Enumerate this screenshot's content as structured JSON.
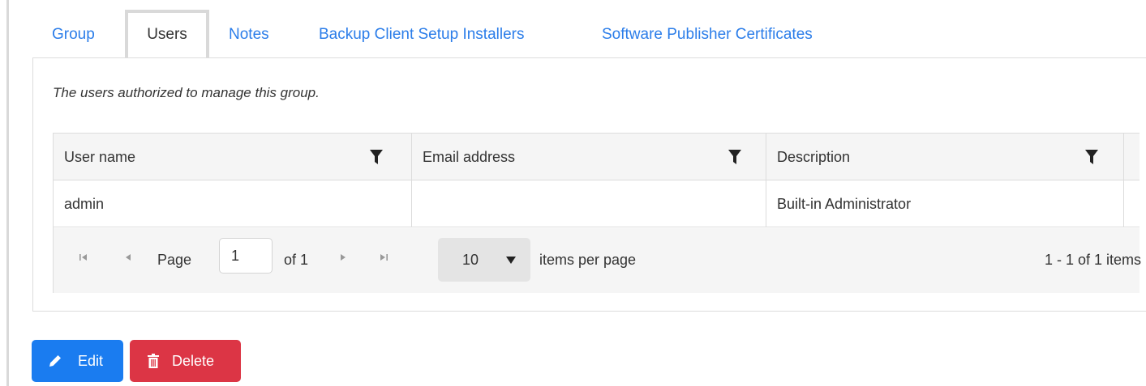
{
  "tabs": [
    {
      "label": "Group",
      "active": false
    },
    {
      "label": "Users",
      "active": true
    },
    {
      "label": "Notes",
      "active": false
    },
    {
      "label": "Backup Client Setup Installers",
      "active": false
    },
    {
      "label": "Software Publisher Certificates",
      "active": false
    }
  ],
  "panel": {
    "description": "The users authorized to manage this group."
  },
  "grid": {
    "columns": [
      "User name",
      "Email address",
      "Description"
    ],
    "rows": [
      [
        "admin",
        "",
        "Built-in Administrator"
      ]
    ]
  },
  "pager": {
    "page_label": "Page",
    "current_page": "1",
    "of_label": "of 1",
    "page_size": "10",
    "items_per_page_label": "items per page",
    "summary": "1 - 1 of 1 items"
  },
  "actions": {
    "edit_label": "Edit",
    "delete_label": "Delete"
  },
  "colors": {
    "link": "#2b7de9",
    "edit_button": "#1a7cf0",
    "delete_button": "#dc3545",
    "header_bg": "#f5f5f5"
  },
  "icons": [
    "filter-icon",
    "seek-first-icon",
    "previous-icon",
    "next-icon",
    "seek-last-icon",
    "chevron-down-icon",
    "pencil-icon",
    "trash-icon"
  ]
}
